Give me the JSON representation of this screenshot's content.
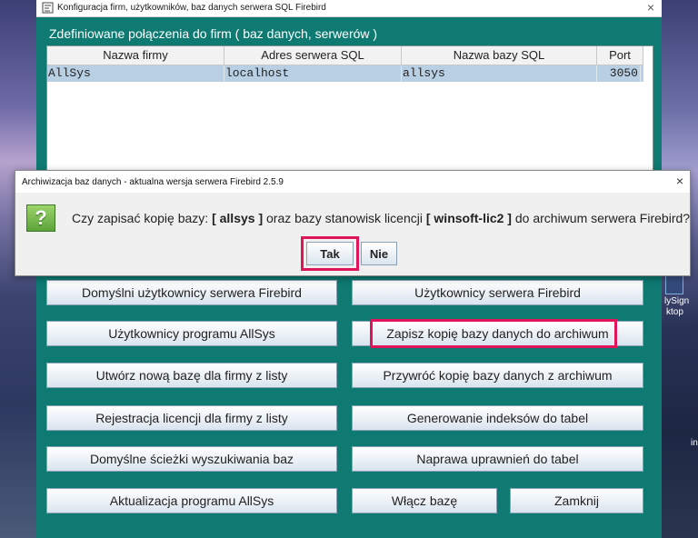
{
  "desktop": {
    "labels": [
      "lySign",
      "ktop"
    ],
    "edge_text": "in"
  },
  "main_window": {
    "title": "Konfiguracja firm, użytkowników, baz danych serwera SQL Firebird",
    "close_glyph": "×",
    "section_title": "Zdefiniowane połączenia do firm ( baz danych, serwerów )",
    "table": {
      "columns": [
        "Nazwa firmy",
        "Adres serwera SQL",
        "Nazwa bazy SQL",
        "Port"
      ],
      "rows": [
        [
          "AllSys",
          "localhost",
          "allsys",
          "3050"
        ]
      ]
    },
    "buttons": {
      "default_users": "Domyślni użytkownicy serwera Firebird",
      "server_users": "Użytkownicy serwera Firebird",
      "program_users": "Użytkownicy programu AllSys",
      "backup": "Zapisz kopię bazy danych do archiwum",
      "new_db": "Utwórz nową bazę dla firmy z listy",
      "restore": "Przywróć kopię bazy danych z archiwum",
      "license": "Rejestracja licencji dla firmy z listy",
      "indexes": "Generowanie indeksów do tabel",
      "paths": "Domyślne ścieżki wyszukiwania baz",
      "permissions": "Naprawa uprawnień do tabel",
      "update": "Aktualizacja programu AllSys",
      "enable_db": "Włącz bazę",
      "close": "Zamknij"
    }
  },
  "dialog": {
    "title": "Archiwizacja baz danych - aktualna wersja serwera Firebird 2.5.9",
    "close_glyph": "×",
    "icon_glyph": "?",
    "message_part1": "Czy zapisać kopię bazy: ",
    "db_name": "[ allsys ]",
    "message_part2": " oraz bazy stanowisk licencji ",
    "license_db": "[ winsoft-lic2 ]",
    "message_part3": " do archiwum serwera Firebird?",
    "yes_label": "Tak",
    "no_label": "Nie"
  },
  "colors": {
    "window_bg": "#0e7a72",
    "highlight": "#e0145a",
    "selected_row": "#b8cfe4"
  }
}
